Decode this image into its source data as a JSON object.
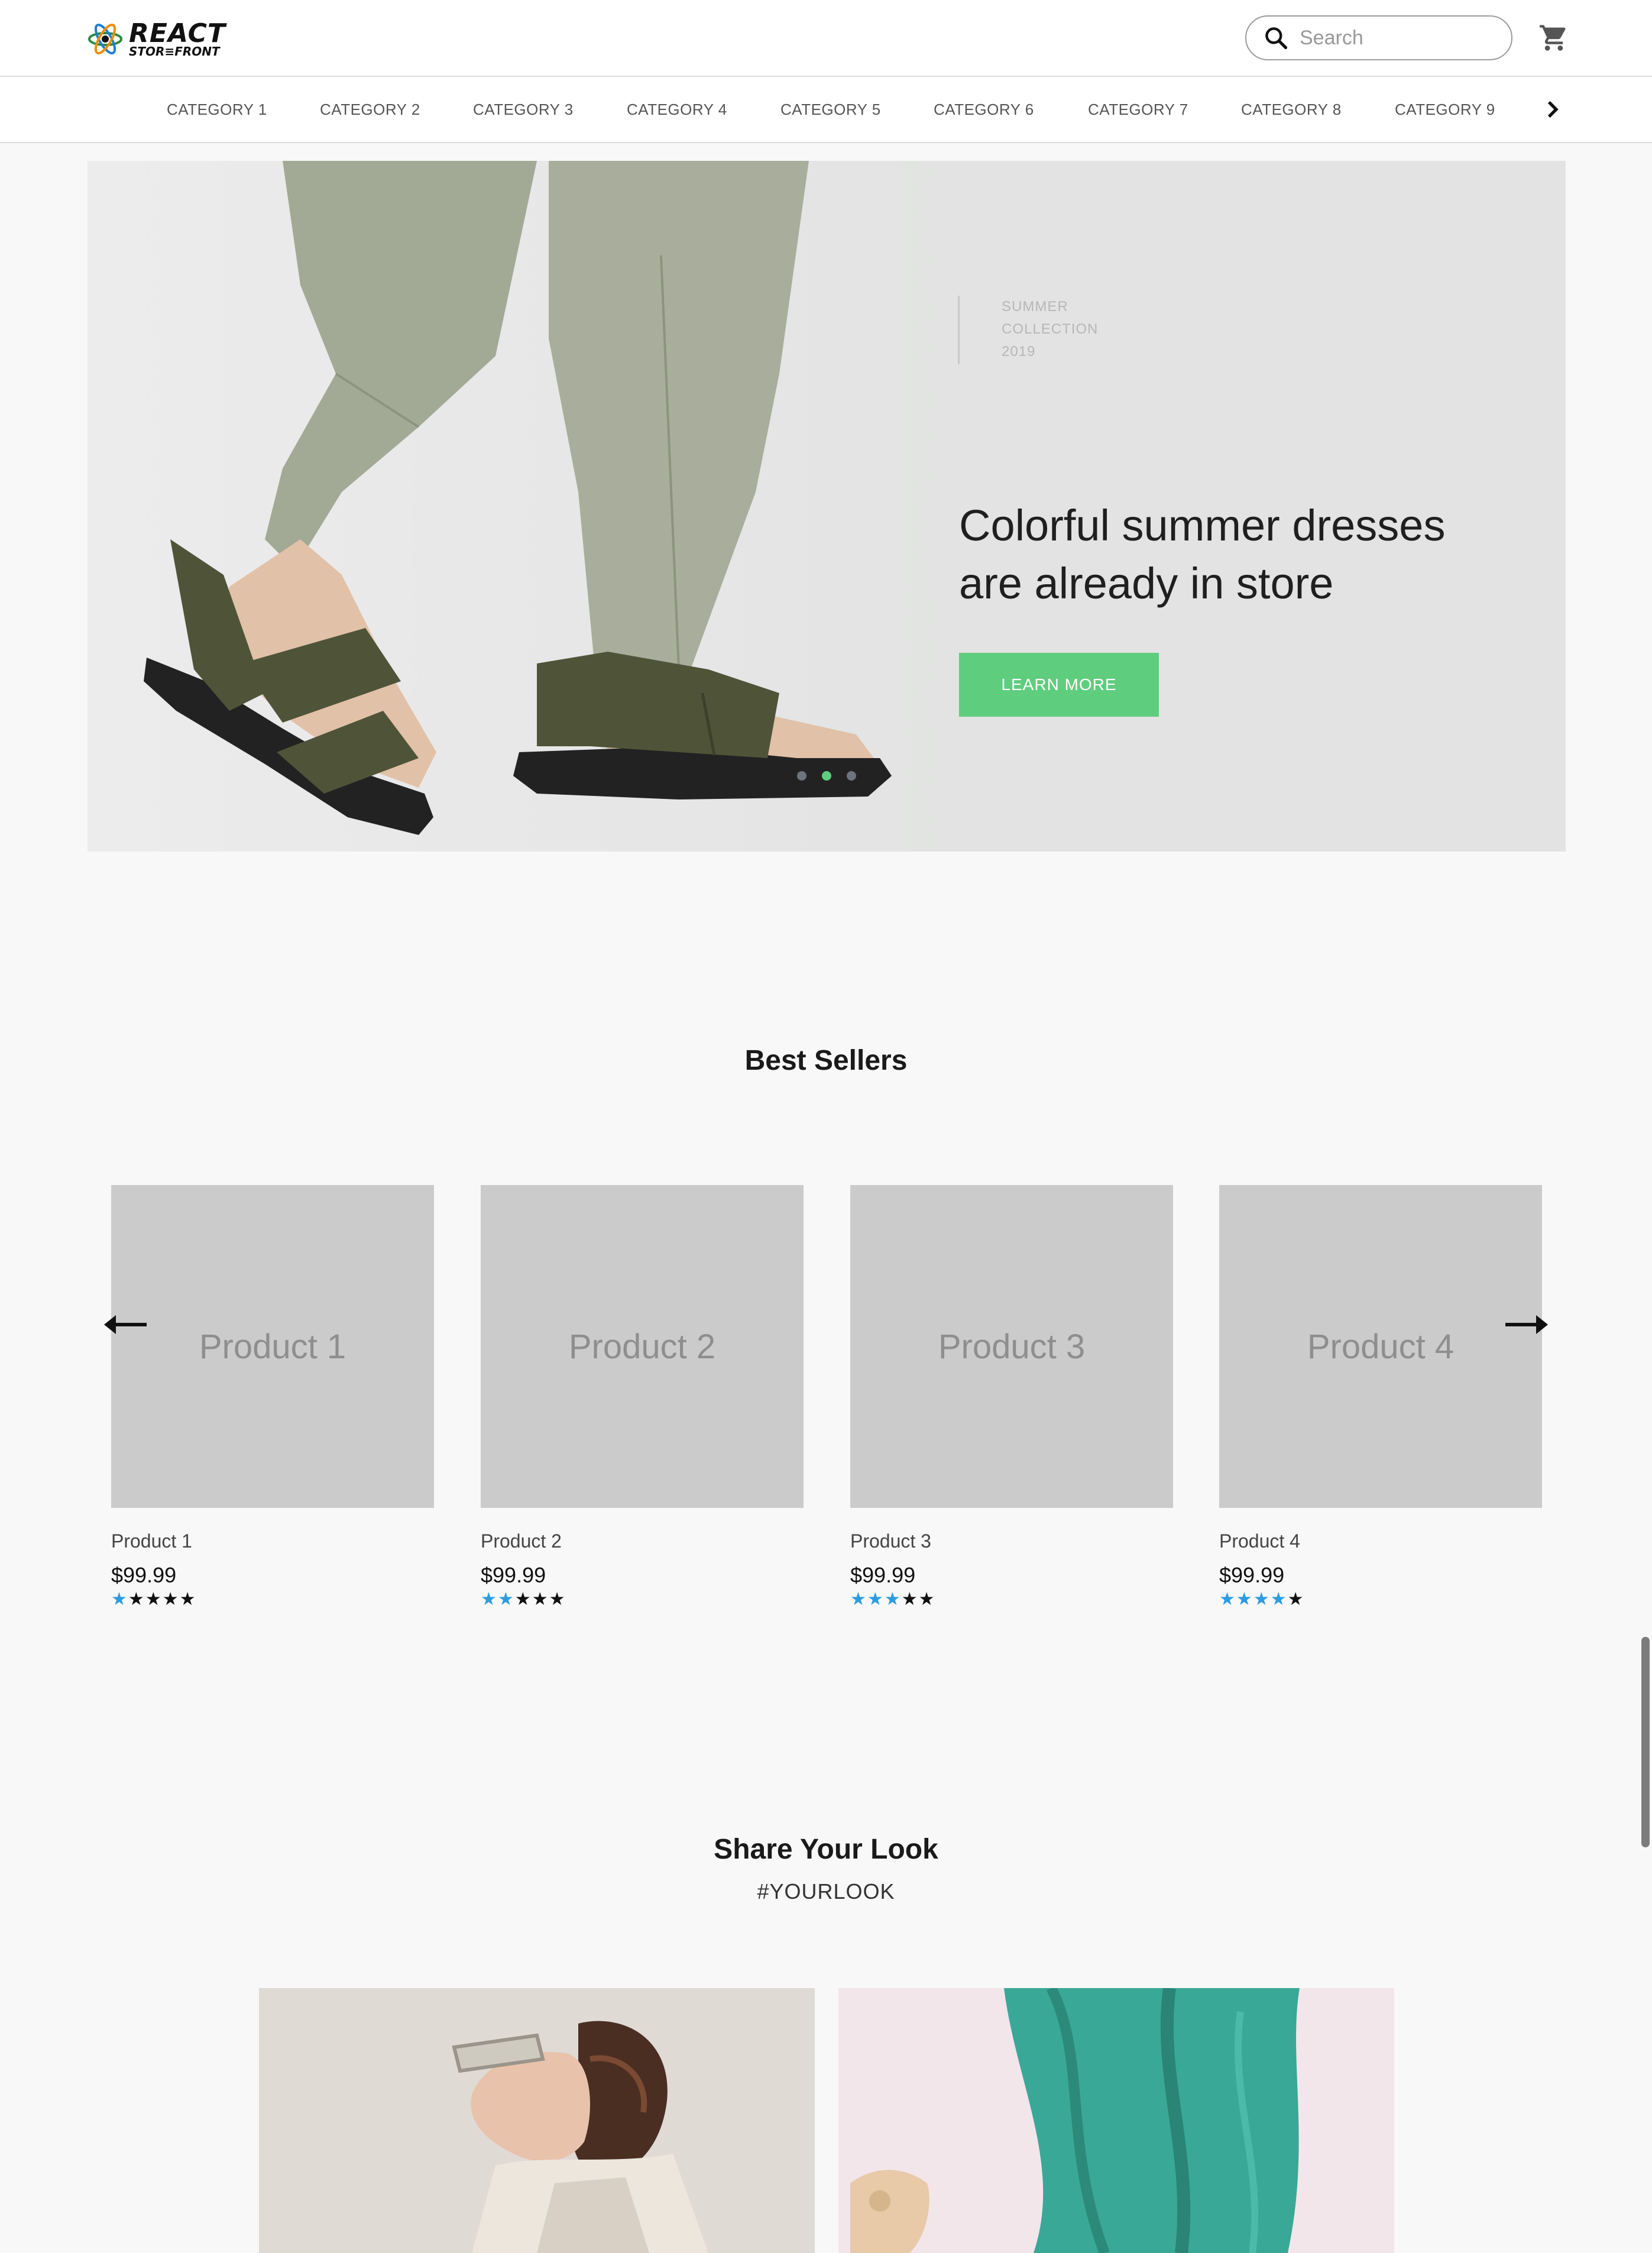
{
  "header": {
    "logo_line1": "REACT",
    "logo_line2": "STOR≡FRONT",
    "search_placeholder": "Search",
    "cart_icon": "cart-icon"
  },
  "categories": [
    "CATEGORY 1",
    "CATEGORY 2",
    "CATEGORY 3",
    "CATEGORY 4",
    "CATEGORY 5",
    "CATEGORY 6",
    "CATEGORY 7",
    "CATEGORY 8",
    "CATEGORY 9"
  ],
  "hero": {
    "kicker_line1": "SUMMER",
    "kicker_line2": "COLLECTION",
    "kicker_line3": "2019",
    "title_line1": "Colorful summer dresses",
    "title_line2": "are already in store",
    "button_label": "LEARN MORE",
    "slides_count": 3,
    "active_slide": 2,
    "accent_color": "#5fcd7e"
  },
  "best_sellers": {
    "title": "Best Sellers",
    "products": [
      {
        "image_label": "Product 1",
        "name": "Product 1",
        "price": "$99.99",
        "rating": 1
      },
      {
        "image_label": "Product 2",
        "name": "Product 2",
        "price": "$99.99",
        "rating": 2
      },
      {
        "image_label": "Product 3",
        "name": "Product 3",
        "price": "$99.99",
        "rating": 3
      },
      {
        "image_label": "Product 4",
        "name": "Product 4",
        "price": "$99.99",
        "rating": 4
      }
    ],
    "rating_max": 5,
    "star_filled_color": "#2d9be0",
    "star_empty_color": "#111111"
  },
  "share": {
    "title": "Share Your Look",
    "hashtag": "#YOURLOOK"
  }
}
